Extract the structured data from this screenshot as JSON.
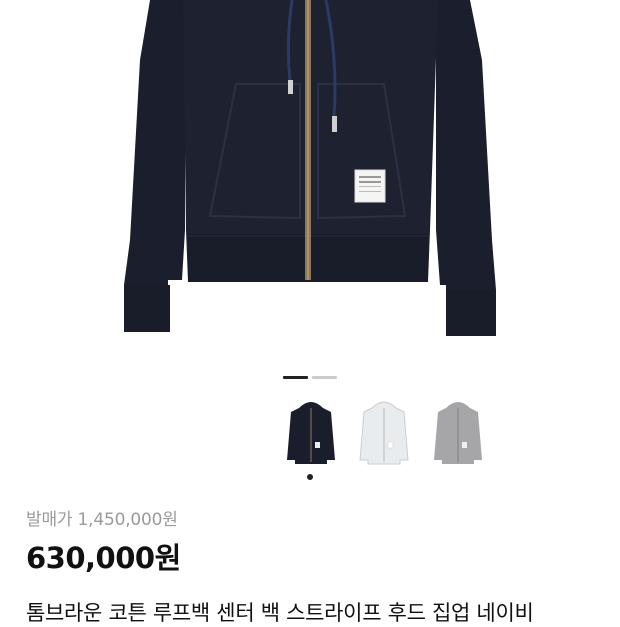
{
  "product": {
    "original_price_label": "발매가",
    "original_price_value": "1,450,000원",
    "sale_price": "630,000원",
    "name": "톰브라운 코튼 루프백 센터 백 스트라이프 후드 집업 네이비"
  },
  "gallery": {
    "slide_count": 2,
    "active_slide": 1,
    "hero_color": "navy"
  },
  "color_options": [
    {
      "name": "navy",
      "color": "#1a1d2b",
      "selected": true
    },
    {
      "name": "white",
      "color": "#e9ecef",
      "selected": false
    },
    {
      "name": "grey",
      "color": "#a6a6a8",
      "selected": false
    }
  ],
  "colors": {
    "navy": "#1b1e2c",
    "text_primary": "#111111",
    "text_muted": "#9a9a9a",
    "indicator_active": "#222222",
    "indicator_inactive": "#cccccc"
  }
}
